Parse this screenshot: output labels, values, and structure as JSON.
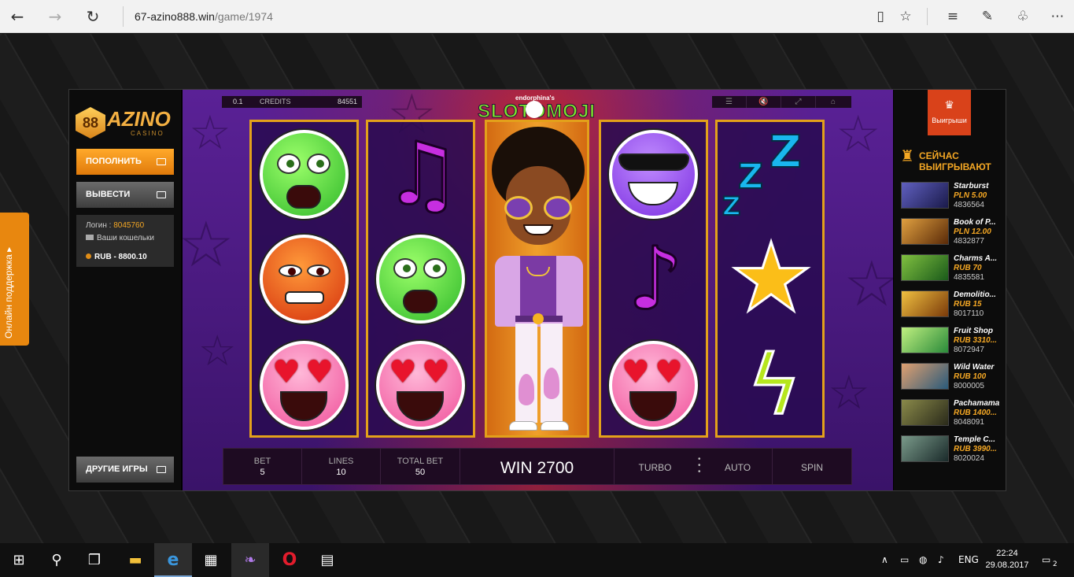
{
  "browser": {
    "url_host": "67-azino888.win",
    "url_path": "/game/1974",
    "back_icon": "←",
    "forward_icon": "→",
    "refresh_icon": "↻",
    "reading_icon": "▯",
    "favorite_icon": "☆",
    "hub_icon": "≡",
    "note_icon": "✎",
    "share_icon": "♧",
    "more_icon": "⋯"
  },
  "casino": {
    "logo_badge": "88",
    "logo_word": "AZINO",
    "logo_sub": "CASINO",
    "topup_label": "ПОПОЛНИТЬ",
    "withdraw_label": "ВЫВЕСТИ",
    "login_label": "Логин : ",
    "login_value": "8045760",
    "wallets_label": "Ваши кошельки",
    "balance": "RUB - 8800.10",
    "other_games_label": "ДРУГИЕ ИГРЫ",
    "support_label": "Онлайн поддержка ▸"
  },
  "game": {
    "bet_value_top": "0.1",
    "credits_label": "CREDITS",
    "credits_value": "84551",
    "title_small": "endorphina's",
    "title_big": "SLOTOMOJI",
    "bet_label": "BET",
    "bet_value": "5",
    "lines_label": "LINES",
    "lines_value": "10",
    "total_bet_label": "TOTAL BET",
    "total_bet_value": "50",
    "win_text": "WIN 2700",
    "turbo_label": "TURBO",
    "auto_label": "AUTO",
    "spin_label": "SPIN",
    "menu_icons": [
      "☰",
      "🔇",
      "⤢",
      "⌂"
    ]
  },
  "winners": {
    "tab_label": "Выигрыши",
    "heading": "СЕЙЧАС ВЫИГРЫВАЮТ",
    "items": [
      {
        "name": "Starburst",
        "amount": "PLN 5.00",
        "id": "4836564",
        "color": "#2a2a5a"
      },
      {
        "name": "Book of P...",
        "amount": "PLN 12.00",
        "id": "4832877",
        "color": "#6a3a10"
      },
      {
        "name": "Charms A...",
        "amount": "RUB 70",
        "id": "4835581",
        "color": "#2a6a2a"
      },
      {
        "name": "Demolitio...",
        "amount": "RUB 15",
        "id": "8017110",
        "color": "#7a4a1a"
      },
      {
        "name": "Fruit Shop",
        "amount": "RUB 3310...",
        "id": "8072947",
        "color": "#2a7a4a"
      },
      {
        "name": "Wild Water",
        "amount": "RUB 100",
        "id": "8000005",
        "color": "#3a6a8a"
      },
      {
        "name": "Pachamama",
        "amount": "RUB 1400...",
        "id": "8048091",
        "color": "#4a4a2a"
      },
      {
        "name": "Temple C...",
        "amount": "RUB 3990...",
        "id": "8020024",
        "color": "#3a4a4a"
      }
    ]
  },
  "taskbar": {
    "start_icon": "⊞",
    "search_icon": "⚲",
    "task_view_icon": "❐",
    "explorer_icon": "▬",
    "edge_icon": "e",
    "store_icon": "▦",
    "feather_icon": "❧",
    "opera_icon": "O",
    "media_icon": "▤",
    "tray_up": "∧",
    "battery_icon": "▭",
    "network_icon": "◍",
    "volume_icon": "♪",
    "lang": "ENG",
    "time": "22:24",
    "date": "29.08.2017",
    "notification_icon": "▭",
    "notification_count": "2"
  }
}
